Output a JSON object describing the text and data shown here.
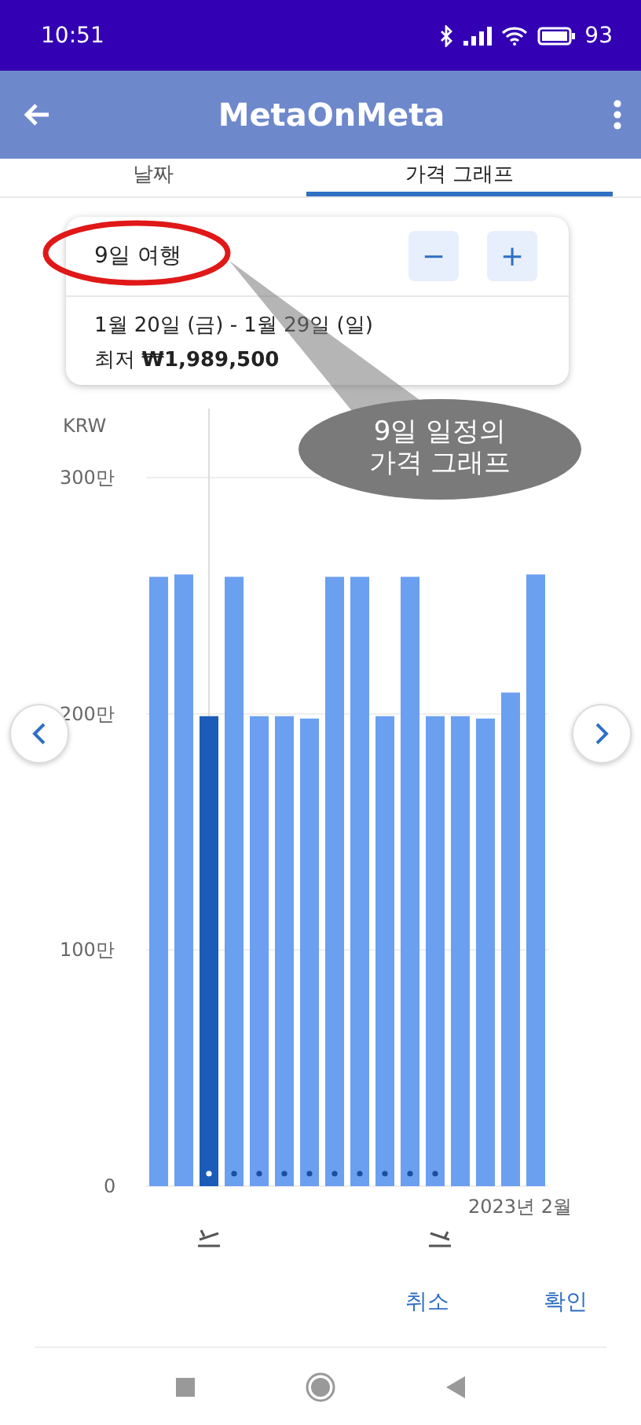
{
  "status_bar": {
    "time": "10:51",
    "battery": "93"
  },
  "app_bar": {
    "title": "MetaOnMeta"
  },
  "tabs": [
    {
      "label": "날짜",
      "selected": false
    },
    {
      "label": "가격 그래프",
      "selected": true
    }
  ],
  "trip_card": {
    "duration": "9일 여행",
    "decrease": "−",
    "increase": "+",
    "dates": "1월 20일 (금) - 1월 29일 (일)",
    "price": "최저 **₩1,989,500**"
  },
  "callout": {
    "text": "9일 일정의\n가격 그래프"
  },
  "chart": {
    "chart_data": {
      "type": "bar",
      "ylabel": "KRW",
      "values": [
        258,
        259,
        199,
        258,
        199,
        199,
        198,
        258,
        258,
        199,
        258,
        199,
        199,
        198,
        209,
        259
      ],
      "ylim": [
        0,
        300
      ],
      "yticks": [
        {
          "value": 0,
          "label": "0"
        },
        {
          "value": 100,
          "label": "100만"
        },
        {
          "value": 200,
          "label": "200만"
        },
        {
          "value": 300,
          "label": "300만"
        }
      ]
    },
    "bars": [
      {
        "selected": false,
        "in_trip": false
      },
      {
        "selected": false,
        "in_trip": false
      },
      {
        "selected": true,
        "in_trip": true
      },
      {
        "selected": false,
        "in_trip": true
      },
      {
        "selected": false,
        "in_trip": true
      },
      {
        "selected": false,
        "in_trip": true
      },
      {
        "selected": false,
        "in_trip": true
      },
      {
        "selected": false,
        "in_trip": true
      },
      {
        "selected": false,
        "in_trip": true
      },
      {
        "selected": false,
        "in_trip": true
      },
      {
        "selected": false,
        "in_trip": true
      },
      {
        "selected": false,
        "in_trip": true
      },
      {
        "selected": false,
        "in_trip": false
      },
      {
        "selected": false,
        "in_trip": false
      },
      {
        "selected": false,
        "in_trip": false
      },
      {
        "selected": false,
        "in_trip": false
      }
    ],
    "month_label": "2023년 2월"
  },
  "actions": [
    {
      "label": "취소"
    },
    {
      "label": "확인"
    }
  ]
}
